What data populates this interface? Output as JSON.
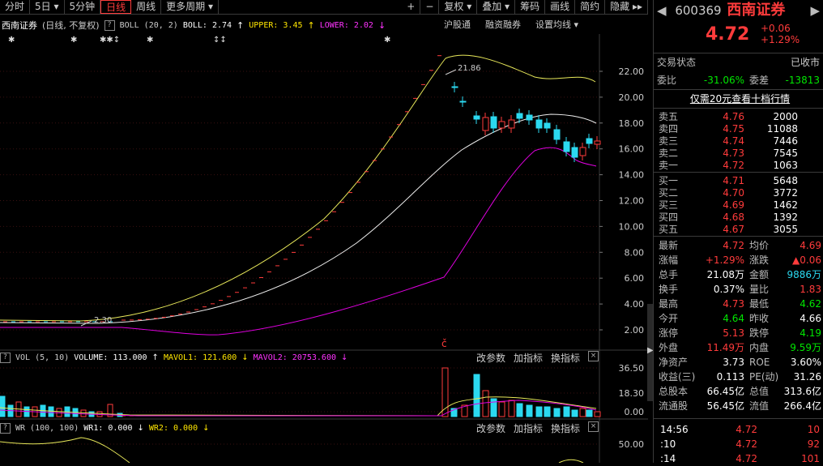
{
  "toolbar": {
    "items": [
      "分时",
      "5日 ▾",
      "5分钟",
      "日线",
      "周线",
      "更多周期 ▾",
      "+",
      "−",
      "复权 ▾",
      "叠加 ▾",
      "筹码",
      "画线",
      "简约",
      "隐藏 ▸▸"
    ],
    "active": "日线"
  },
  "main": {
    "stock_name": "西南证券",
    "period_note": "(日线, 不复权)",
    "boll": {
      "name": "BOLL (20, 2)",
      "boll": "BOLL: 2.74",
      "upper": "UPPER: 3.45",
      "lower": "LOWER: 2.02"
    },
    "tabs": [
      "沪股通",
      "融资融券",
      "设置均线 ▾"
    ],
    "price_axis": [
      "22.00",
      "20.00",
      "18.00",
      "16.00",
      "14.00",
      "12.00",
      "10.00",
      "8.00",
      "6.00",
      "4.00",
      "2.00"
    ],
    "high_marker": "21.86",
    "low_marker": "2.30",
    "marker": "č"
  },
  "vol": {
    "name": "VOL (5, 10)",
    "volume": "VOLUME: 113.000",
    "mavol1": "MAVOL1: 121.600",
    "mavol2": "MAVOL2: 20753.600",
    "axis": [
      "36.50",
      "18.30",
      "0.00"
    ],
    "buttons": [
      "改参数",
      "加指标",
      "换指标",
      "×"
    ]
  },
  "wr": {
    "name": "WR (100, 100)",
    "wr1": "WR1: 0.000",
    "wr2": "WR2: 0.000",
    "axis": [
      "50.00"
    ],
    "buttons": [
      "改参数",
      "加指标",
      "换指标",
      "×"
    ]
  },
  "quote": {
    "code": "600369",
    "name": "西南证券",
    "price": "4.72",
    "change": "+0.06",
    "pct": "+1.29%",
    "status_label": "交易状态",
    "status": "已收市",
    "ratio_label": "委比",
    "ratio": "-31.06%",
    "diff_label": "委差",
    "diff": "-13813",
    "promo": "仅需20元查看十档行情",
    "asks": [
      {
        "l": "卖五",
        "p": "4.76",
        "v": "2000"
      },
      {
        "l": "卖四",
        "p": "4.75",
        "v": "11088"
      },
      {
        "l": "卖三",
        "p": "4.74",
        "v": "7446"
      },
      {
        "l": "卖二",
        "p": "4.73",
        "v": "7545"
      },
      {
        "l": "卖一",
        "p": "4.72",
        "v": "1063"
      }
    ],
    "bids": [
      {
        "l": "买一",
        "p": "4.71",
        "v": "5648"
      },
      {
        "l": "买二",
        "p": "4.70",
        "v": "3772"
      },
      {
        "l": "买三",
        "p": "4.69",
        "v": "1462"
      },
      {
        "l": "买四",
        "p": "4.68",
        "v": "1392"
      },
      {
        "l": "买五",
        "p": "4.67",
        "v": "3055"
      }
    ],
    "stats": [
      {
        "a": "最新",
        "av": "4.72",
        "ac": "red",
        "b": "均价",
        "bv": "4.69",
        "bc": "red"
      },
      {
        "a": "涨幅",
        "av": "+1.29%",
        "ac": "red",
        "b": "涨跌",
        "bv": "▲0.06",
        "bc": "red"
      },
      {
        "a": "总手",
        "av": "21.08万",
        "ac": "wht",
        "b": "金额",
        "bv": "9886万",
        "bc": "cyan"
      },
      {
        "a": "换手",
        "av": "0.37%",
        "ac": "wht",
        "b": "量比",
        "bv": "1.83",
        "bc": "red"
      },
      {
        "a": "最高",
        "av": "4.73",
        "ac": "red",
        "b": "最低",
        "bv": "4.62",
        "bc": "grn"
      },
      {
        "a": "今开",
        "av": "4.64",
        "ac": "grn",
        "b": "昨收",
        "bv": "4.66",
        "bc": "wht"
      },
      {
        "a": "涨停",
        "av": "5.13",
        "ac": "red",
        "b": "跌停",
        "bv": "4.19",
        "bc": "grn"
      },
      {
        "a": "外盘",
        "av": "11.49万",
        "ac": "red",
        "b": "内盘",
        "bv": "9.59万",
        "bc": "grn"
      },
      {
        "a": "净资产",
        "av": "3.73",
        "ac": "wht",
        "b": "ROE",
        "bv": "3.60%",
        "bc": "wht"
      },
      {
        "a": "收益(三)",
        "av": "0.113",
        "ac": "wht",
        "b": "PE(动)",
        "bv": "31.26",
        "bc": "wht"
      },
      {
        "a": "总股本",
        "av": "66.45亿",
        "ac": "wht",
        "b": "总值",
        "bv": "313.6亿",
        "bc": "wht"
      },
      {
        "a": "流通股",
        "av": "56.45亿",
        "ac": "wht",
        "b": "流值",
        "bv": "266.4亿",
        "bc": "wht"
      }
    ],
    "ticks": [
      {
        "t": "14:56",
        "p": "4.72",
        "v": "10"
      },
      {
        "t": ":10",
        "p": "4.72",
        "v": "92"
      },
      {
        "t": ":14",
        "p": "4.72",
        "v": "101"
      }
    ]
  }
}
